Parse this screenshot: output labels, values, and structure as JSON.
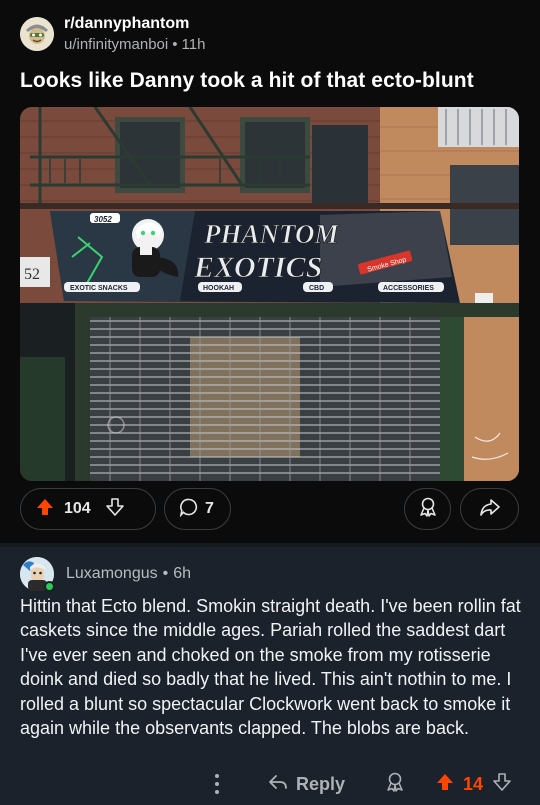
{
  "post": {
    "subreddit": "r/dannyphantom",
    "author": "u/infinitymanboi",
    "age": "11h",
    "title": "Looks like Danny took a hit of that ecto-blunt",
    "image": {
      "sign_number": "3052",
      "store_name_line1": "PHANTOM",
      "store_name_line2": "EXOTICS",
      "sign_badge": "Smoke Shop",
      "side_number": "52",
      "sign_items": [
        "EXOTIC SNACKS",
        "HOOKAH",
        "CBD",
        "ACCESSORIES"
      ]
    },
    "upvotes": "104",
    "comments": "7",
    "colors": {
      "upvote": "#ff4500"
    }
  },
  "comment": {
    "username": "Luxamongus",
    "age": "6h",
    "body": "Hittin that Ecto blend. Smokin straight death. I've been rollin fat caskets since the middle ages. Pariah rolled the saddest dart I've ever seen and choked on the smoke from my rotisserie doink and died so badly that he lived. This ain't nothin to me. I rolled a blunt so spectacular Clockwork went back to smoke it again while the observants clapped. The blobs are back.",
    "reply_label": "Reply",
    "score": "14"
  },
  "icons": {
    "upvote": "arrow-up-icon",
    "downvote": "arrow-down-icon",
    "comment": "speech-bubble-icon",
    "award": "award-icon",
    "share": "share-arrow-icon",
    "reply": "reply-arrow-icon",
    "more": "vertical-dots-icon"
  }
}
